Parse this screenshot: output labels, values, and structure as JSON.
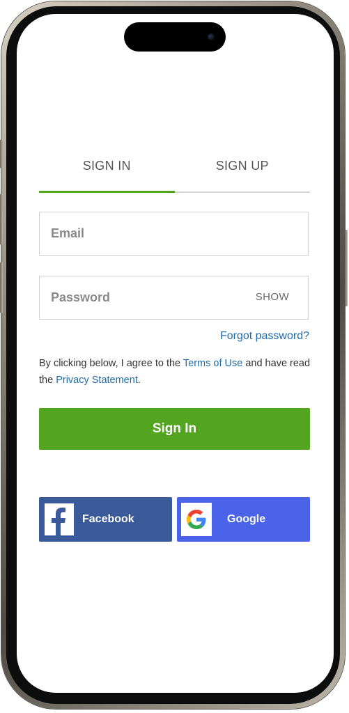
{
  "auth": {
    "tabs": [
      {
        "label": "SIGN IN",
        "active": true
      },
      {
        "label": "SIGN UP",
        "active": false
      }
    ],
    "email": {
      "placeholder": "Email",
      "value": ""
    },
    "password": {
      "placeholder": "Password",
      "value": "",
      "show_label": "SHOW"
    },
    "forgot_label": "Forgot password?",
    "terms": {
      "prefix": "By clicking below, I agree to the ",
      "terms_link": "Terms of Use",
      "middle": " and have read the ",
      "privacy_link": "Privacy Statement",
      "suffix": "."
    },
    "signin_label": "Sign In",
    "social": {
      "facebook_label": "Facebook",
      "google_label": "Google"
    }
  },
  "colors": {
    "accent_green": "#53a51f",
    "link_blue": "#1e6aa8",
    "facebook_blue": "#3b5a9a",
    "google_blue": "#4a63e8"
  },
  "icons": [
    "facebook-logo-icon",
    "google-logo-icon",
    "camera-icon"
  ]
}
